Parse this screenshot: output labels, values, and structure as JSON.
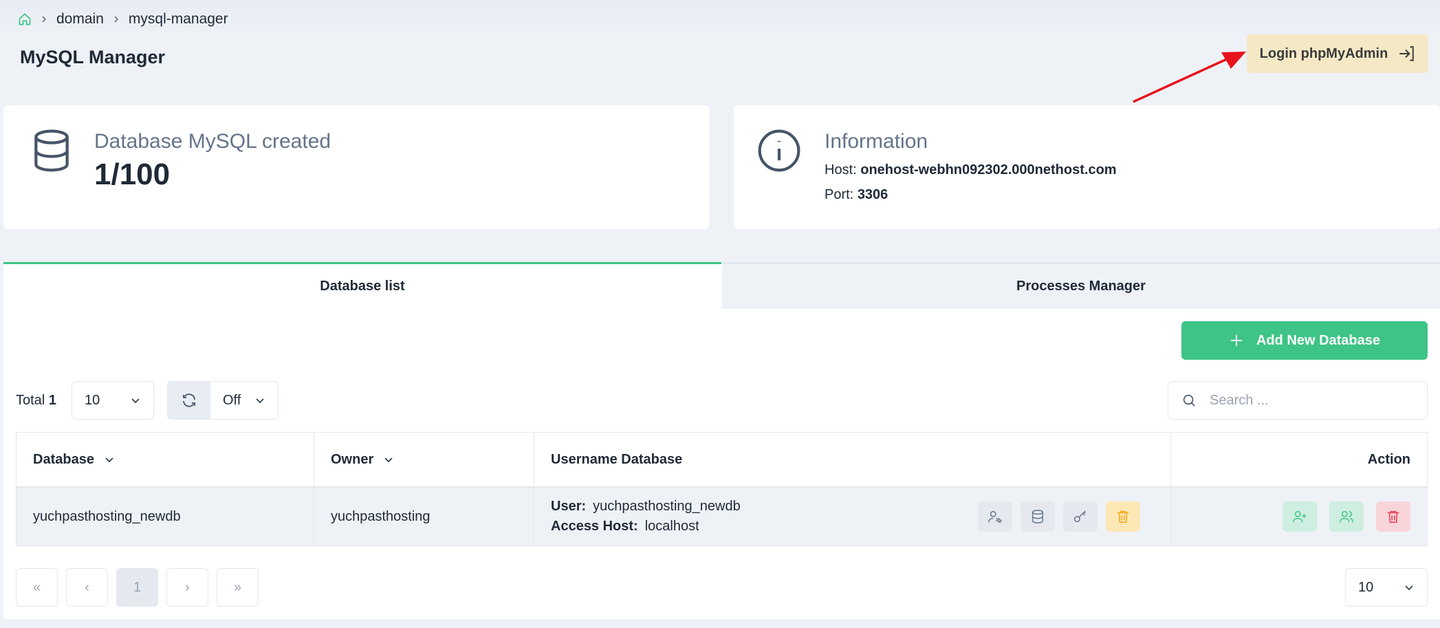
{
  "breadcrumb": {
    "items": [
      "domain",
      "mysql-manager"
    ]
  },
  "page": {
    "title": "MySQL Manager"
  },
  "header": {
    "pma_button_label": "Login phpMyAdmin"
  },
  "stats_card": {
    "label": "Database MySQL created",
    "value": "1/100"
  },
  "info_card": {
    "title": "Information",
    "host_label": "Host:",
    "host_value": "onehost-webhn092302.000nethost.com",
    "port_label": "Port:",
    "port_value": "3306"
  },
  "tabs": [
    {
      "label": "Database list",
      "active": true
    },
    {
      "label": "Processes Manager",
      "active": false
    }
  ],
  "toolbar": {
    "add_button_label": "Add New Database",
    "total_label": "Total",
    "total_value": "1",
    "page_size": "10",
    "auto_refresh": "Off",
    "search_placeholder": "Search ..."
  },
  "table": {
    "headers": [
      "Database",
      "Owner",
      "Username Database",
      "Action"
    ],
    "rows": [
      {
        "database": "yuchpasthosting_newdb",
        "owner": "yuchpasthosting",
        "user_label": "User:",
        "user_value": "yuchpasthosting_newdb",
        "host_label": "Access Host:",
        "host_value": "localhost"
      }
    ]
  },
  "pagination": {
    "first": "«",
    "prev": "‹",
    "current": "1",
    "next": "›",
    "last": "»",
    "page_size": "10"
  },
  "colors": {
    "accent": "#3ec486",
    "pma_button": "#f5e8c5",
    "annotation_arrow": "#e8121b"
  },
  "icons": [
    "home-icon",
    "chevron-right-icon",
    "login-icon",
    "database-icon",
    "info-icon",
    "plus-icon",
    "chevron-down-icon",
    "refresh-icon",
    "search-icon",
    "user-settings-icon",
    "key-icon",
    "trash-icon",
    "user-plus-icon",
    "users-icon"
  ]
}
